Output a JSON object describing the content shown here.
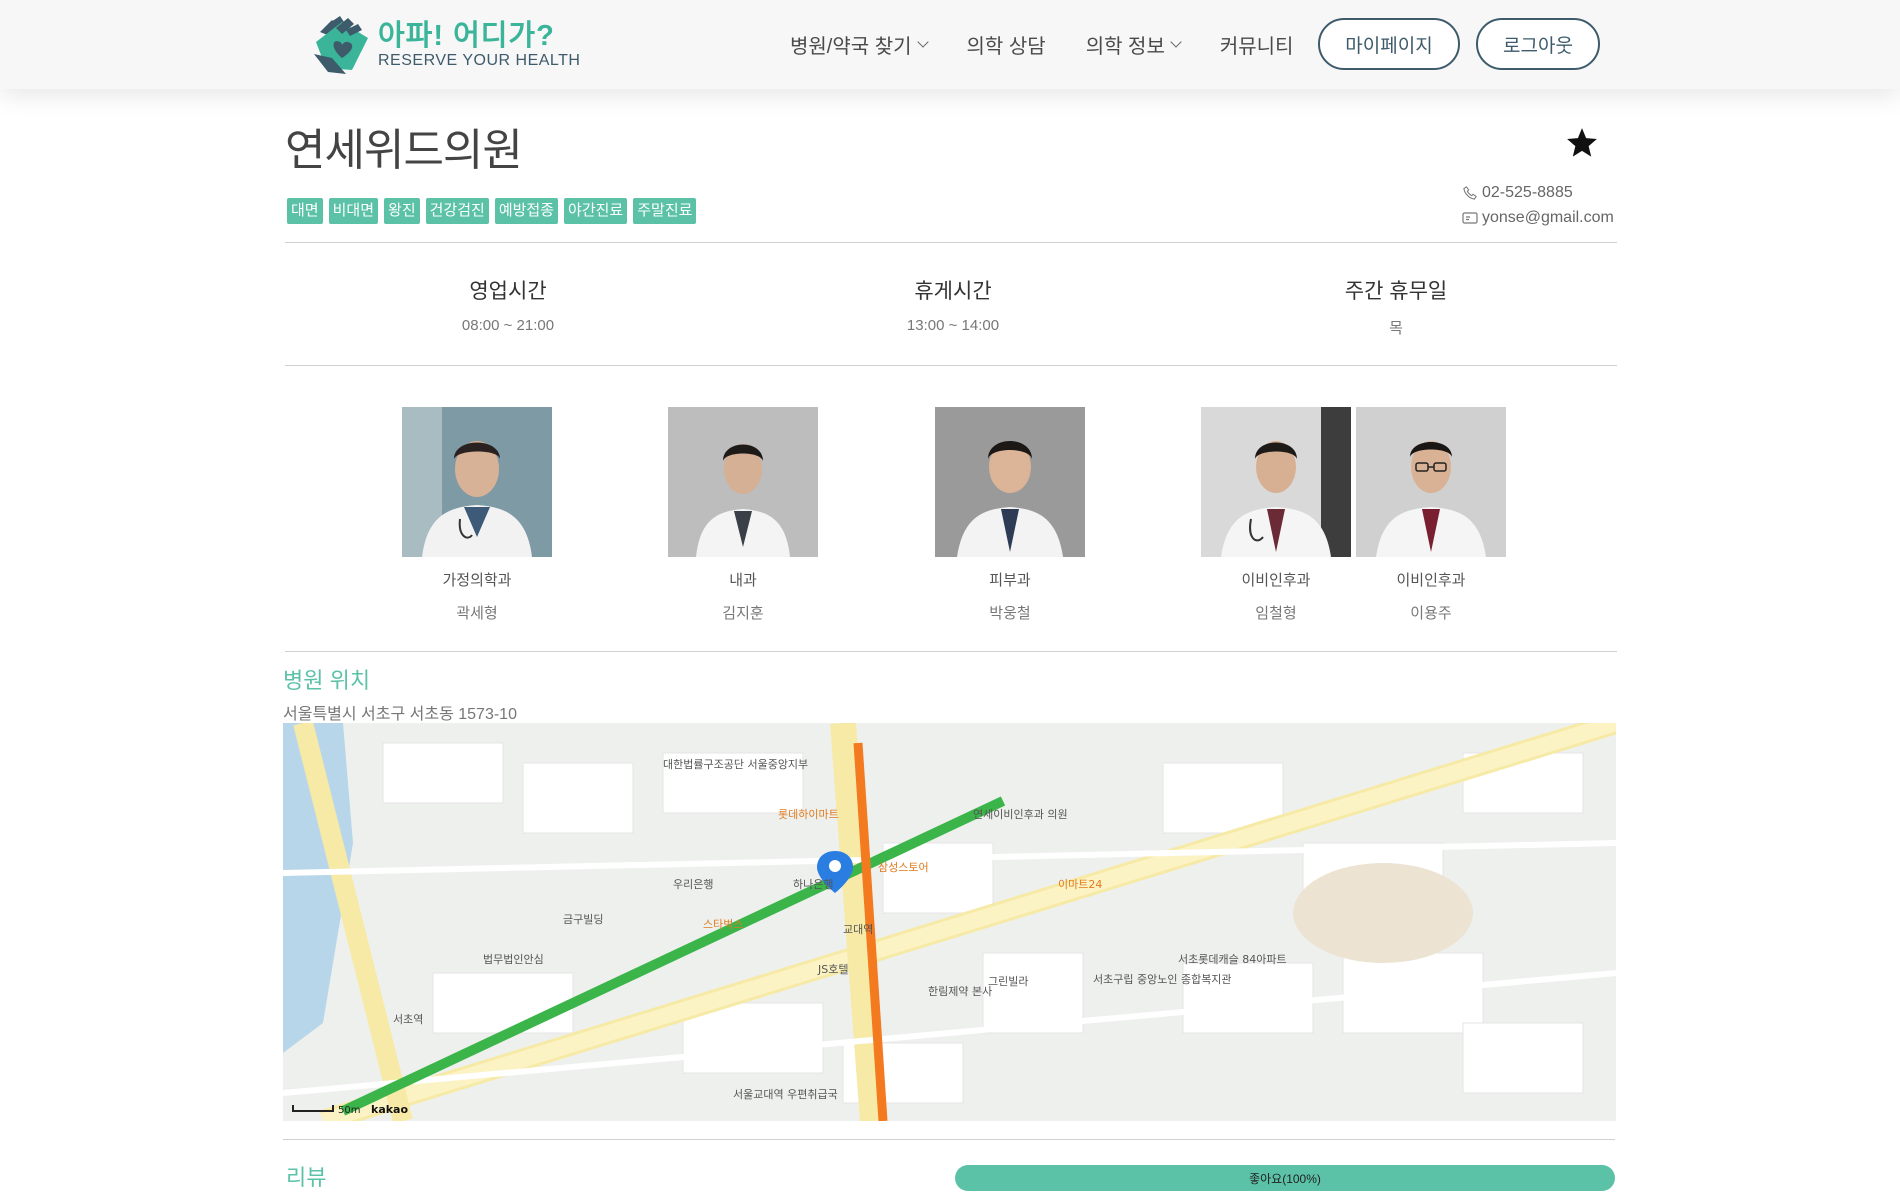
{
  "brand": {
    "title": "아파! 어디가?",
    "subtitle": "RESERVE YOUR HEALTH",
    "primary_color": "#5bc2a8",
    "dark_color": "#3d5b6b"
  },
  "nav": {
    "items": [
      {
        "label": "병원/약국 찾기",
        "has_dropdown": true
      },
      {
        "label": "의학 상담",
        "has_dropdown": false
      },
      {
        "label": "의학 정보",
        "has_dropdown": true
      },
      {
        "label": "커뮤니티",
        "has_dropdown": false
      }
    ],
    "mypage_label": "마이페이지",
    "logout_label": "로그아웃"
  },
  "hospital": {
    "name": "연세위드의원",
    "favorite_icon": "star-icon",
    "tags": [
      "대면",
      "비대면",
      "왕진",
      "건강검진",
      "예방접종",
      "야간진료",
      "주말진료"
    ],
    "phone": "02-525-8885",
    "email": "yonse@gmail.com"
  },
  "hours": {
    "business_label": "영업시간",
    "business_value": "08:00 ~ 21:00",
    "break_label": "휴게시간",
    "break_value": "13:00 ~ 14:00",
    "closed_label": "주간 휴무일",
    "closed_value": "목"
  },
  "doctors": [
    {
      "dept": "가정의학과",
      "name": "곽세형"
    },
    {
      "dept": "내과",
      "name": "김지훈"
    },
    {
      "dept": "피부과",
      "name": "박웅철"
    },
    {
      "dept": "이비인후과",
      "name": "임철형"
    },
    {
      "dept": "이비인후과",
      "name": "이용주"
    }
  ],
  "location": {
    "title": "병원 위치",
    "address": "서울특별시 서초구 서초동 1573-10",
    "map_labels": {
      "station1": "교대역",
      "station2": "서초역",
      "bank": "하나은행",
      "bank2": "우리은행",
      "store1": "스타벅스",
      "store2": "롯데하이마트",
      "store3": "삼성스토어",
      "store4": "이마트24",
      "building1": "대한법률구조공단 서울중앙지부",
      "building2": "서울교대역 우편취급국",
      "building3": "한림제약 본사",
      "building4": "서초구립 중앙노인 종합복지관",
      "building5": "금구빌딩",
      "building6": "JS호텔",
      "building7": "연세이비인후과 의원",
      "building8": "서초롯데캐슬 84아파트",
      "building9": "법무법인안심",
      "building10": "그린빌라",
      "scale": "50m",
      "provider": "kakao"
    }
  },
  "review": {
    "title": "리뷰",
    "bar_label": "좋아요(100%)",
    "percent": 100
  }
}
